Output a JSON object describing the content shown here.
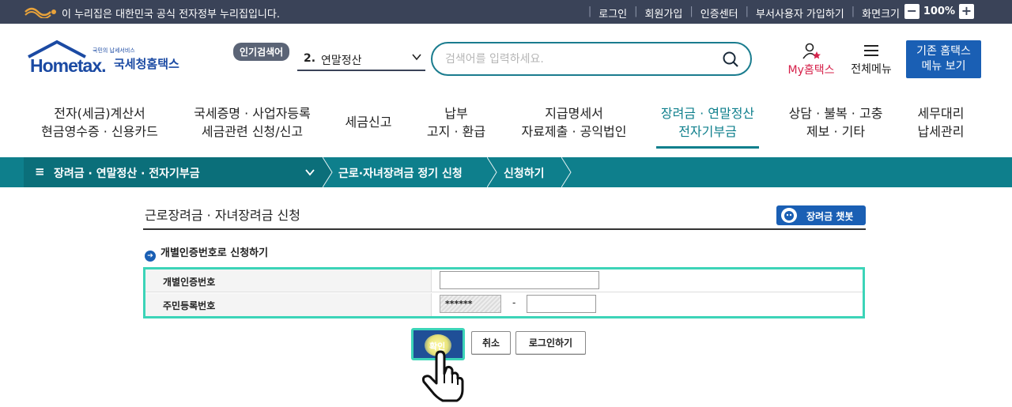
{
  "govbar": {
    "notice": "이 누리집은 대한민국 공식 전자정부 누리집입니다.",
    "links": [
      "로그인",
      "회원가입",
      "인증센터",
      "부서사용자 가입하기",
      "화면크기"
    ],
    "zoom_minus": "−",
    "zoom_value": "100%",
    "zoom_plus": "+"
  },
  "header": {
    "logo_tag": "국민의 납세서비스",
    "logo_word": "Hometax.",
    "logo_kr": "국세청홈택스",
    "popular_label": "인기검색어",
    "popular_rank": "2.",
    "popular_term": "연말정산",
    "search_placeholder": "검색어를 입력하세요.",
    "my_home": "My홈택스",
    "all_menu": "전체메뉴",
    "old_home_line1": "기존 홈택스",
    "old_home_line2": "메뉴 보기"
  },
  "gnb": [
    {
      "l1": "전자(세금)계산서",
      "l2": "현금영수증 · 신용카드"
    },
    {
      "l1": "국세증명 · 사업자등록",
      "l2": "세금관련 신청/신고"
    },
    {
      "l1": "세금신고",
      "l2": ""
    },
    {
      "l1": "납부",
      "l2": "고지 · 환급"
    },
    {
      "l1": "지급명세서",
      "l2": "자료제출 · 공익법인"
    },
    {
      "l1": "장려금 · 연말정산",
      "l2": "전자기부금"
    },
    {
      "l1": "상담 · 불복 · 고충",
      "l2": "제보 · 기타"
    },
    {
      "l1": "세무대리",
      "l2": "납세관리"
    }
  ],
  "breadcrumb": {
    "menu_icon": "≡",
    "level1": "장려금 · 연말정산 · 전자기부금",
    "level2": "근로·자녀장려금 정기 신청",
    "level3": "신청하기"
  },
  "page": {
    "title": "근로장려금 · 자녀장려금 신청",
    "chatbot": "장려금 챗봇",
    "section_title": "개별인증번호로 신청하기",
    "rows": [
      {
        "label": "개별인증번호"
      },
      {
        "label": "주민등록번호",
        "masked": "******",
        "dash": "-"
      }
    ],
    "buttons": {
      "confirm": "확인",
      "cancel": "취소",
      "login": "로그인하기"
    }
  },
  "colors": {
    "gov_bar": "#3a4358",
    "teal": "#0e7f8c",
    "blue": "#1a5fb4",
    "highlight": "#3cd4b8",
    "my_home_red": "#d6214a"
  }
}
